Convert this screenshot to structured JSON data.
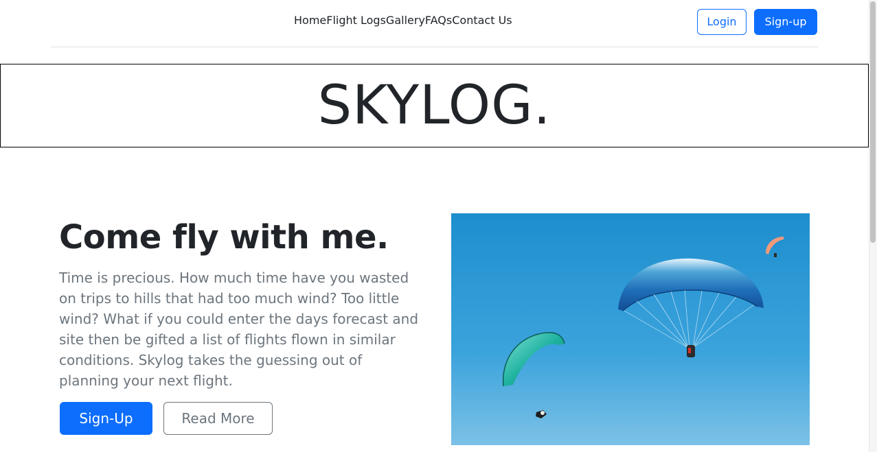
{
  "nav": {
    "links": [
      {
        "label": "Home",
        "active": true
      },
      {
        "label": "Flight Logs",
        "active": false
      },
      {
        "label": "Gallery",
        "active": false
      },
      {
        "label": "FAQs",
        "active": false
      },
      {
        "label": "Contact Us",
        "active": false
      }
    ],
    "login_label": "Login",
    "signup_label": "Sign-up"
  },
  "brand": {
    "title": "SKYLOG."
  },
  "hero": {
    "heading": "Come fly with me.",
    "text": "Time is precious. How much time have you wasted on trips to hills that had too much wind? Too little wind? What if you could enter the days forecast and site then be gifted a list of flights flown in similar conditions. Skylog takes the guessing out of planning your next flight.",
    "primary_label": "Sign-Up",
    "secondary_label": "Read More",
    "image": {
      "subject": "paragliders-in-blue-sky",
      "sky_color": "#2596d4"
    }
  },
  "colors": {
    "primary": "#0d6efd",
    "muted": "#6c757d",
    "text": "#212529"
  }
}
